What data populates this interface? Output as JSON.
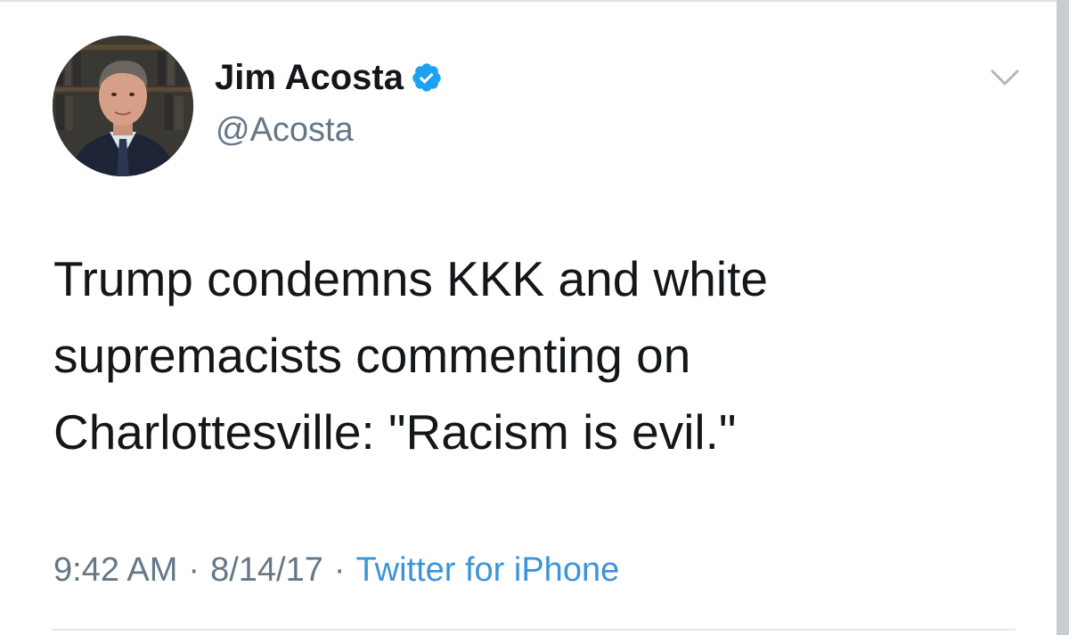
{
  "author": {
    "display_name": "Jim Acosta",
    "handle": "@Acosta",
    "verified": true
  },
  "tweet": {
    "text": "Trump condemns KKK and white\nsupremacists commenting on\nCharlottesville: \"Racism is evil.\""
  },
  "meta": {
    "time": "9:42 AM",
    "separator": "·",
    "date": "8/14/17",
    "source": "Twitter for iPhone"
  },
  "colors": {
    "text": "#14171a",
    "secondary": "#657786",
    "link": "#3b94d9",
    "verified": "#1da1f2"
  },
  "icons": {
    "verified": "verified-badge-icon",
    "menu": "chevron-down-icon"
  }
}
